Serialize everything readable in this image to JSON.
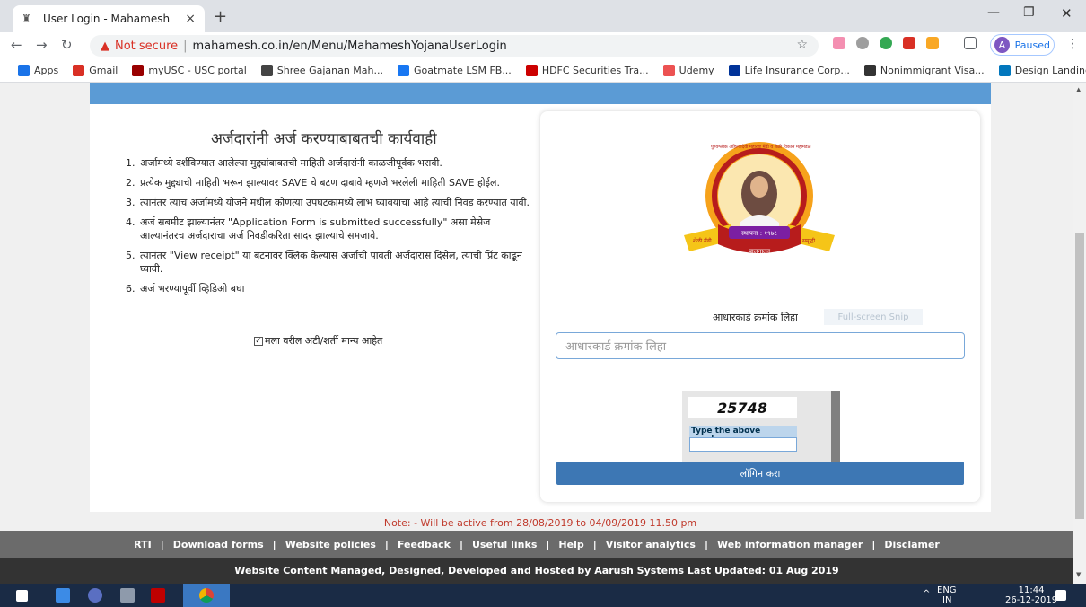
{
  "browser": {
    "tab_title": "User Login - Mahamesh",
    "address_warning": "Not secure",
    "url": "mahamesh.co.in/en/Menu/MahameshYojanaUserLogin",
    "profile_initial": "A",
    "profile_status": "Paused"
  },
  "bookmarks": [
    {
      "label": "Apps",
      "color": "#1a73e8"
    },
    {
      "label": "Gmail",
      "color": "#d93025"
    },
    {
      "label": "myUSC - USC portal",
      "color": "#990000"
    },
    {
      "label": "Shree Gajanan Mah...",
      "color": "#444444"
    },
    {
      "label": "Goatmate LSM FB...",
      "color": "#1877f2"
    },
    {
      "label": "HDFC Securities Tra...",
      "color": "#cc0000"
    },
    {
      "label": "Udemy",
      "color": "#ec5252"
    },
    {
      "label": "Life Insurance Corp...",
      "color": "#003399"
    },
    {
      "label": "Nonimmigrant Visa...",
      "color": "#333333"
    },
    {
      "label": "Design Landing Pag...",
      "color": "#0277bd"
    }
  ],
  "instructions": {
    "heading": "अर्जदारांनी अर्ज करण्याबाबतची कार्यवाही",
    "steps": [
      {
        "n": "1.",
        "text": "अर्जामध्ये दर्शविण्यात आलेल्या मुद्द्यांबाबतची माहिती अर्जदारांनी काळजीपूर्वक भरावी."
      },
      {
        "n": "2.",
        "text": "प्रत्येक मुद्द्याची माहिती भरून झाल्यावर SAVE चे बटण दाबावे म्हणजे भरलेली माहिती SAVE होईल."
      },
      {
        "n": "3.",
        "text": "त्यानंतर त्याच अर्जामध्ये योजने मधील कोणत्या उपघटकामध्ये लाभ घ्यावयाचा आहे त्याची निवड करण्यात यावी."
      },
      {
        "n": "4.",
        "text": "अर्ज सबमीट झाल्यानंतर \"Application Form is submitted successfully\" असा मेसेज आल्यानंतरच अर्जदाराचा अर्ज निवडीकरिता सादर झाल्याचे समजावे."
      },
      {
        "n": "5.",
        "text": "त्यानंतर \"View receipt\" या बटनावर क्लिक केल्यास अर्जाची पावती अर्जदारास दिसेल, त्याची प्रिंट काढून घ्यावी."
      },
      {
        "n": "6.",
        "text": "अर्ज भरण्यापूर्वी व्हिडिओ बघा"
      }
    ],
    "agree_label": "मला वरील अटी/शर्ती मान्य आहेत"
  },
  "login": {
    "logo_top_text": "पुण्यश्लोक अहिल्यादेवी महाराष्ट्र मेंढी व शेळी विकास महामंडळ",
    "logo_ribbon_left": "शेळी मेंढी",
    "logo_ribbon_center": "स्थापना : १९७८",
    "logo_ribbon_right": "समृद्धी",
    "logo_bottom": "पालनातून",
    "aadhar_label": "आधारकार्ड क्रमांक लिहा",
    "snip_text": "Full-screen Snip",
    "aadhar_placeholder": "आधारकार्ड क्रमांक लिहा",
    "captcha_number": "25748",
    "captcha_label": "Type the above number:",
    "login_button": "लॉगिन करा"
  },
  "note": "Note: - Will be active from 28/08/2019 to 04/09/2019 11.50 pm",
  "footer_links": [
    "RTI",
    "Download forms",
    "Website policies",
    "Feedback",
    "Useful links",
    "Help",
    "Visitor analytics",
    "Web information manager",
    "Disclamer"
  ],
  "footer_credit": "Website Content Managed, Designed, Developed and Hosted by Aarush Systems Last Updated: 01 Aug 2019",
  "taskbar": {
    "lang": "ENG",
    "region": "IN",
    "time": "11:44",
    "date": "26-12-2019"
  }
}
